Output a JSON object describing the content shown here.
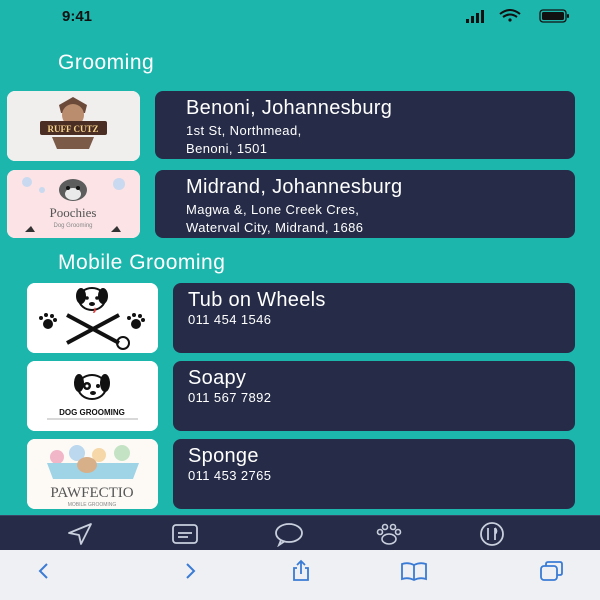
{
  "status": {
    "time": "9:41"
  },
  "sections": {
    "grooming_title": "Grooming",
    "mobile_title": "Mobile Grooming"
  },
  "grooming": [
    {
      "name": "Benoni, Johannesburg",
      "line1": "1st St, Northmead,",
      "line2": "Benoni, 1501",
      "logo_text": "RUFF CUTZ"
    },
    {
      "name": "Midrand, Johannesburg",
      "line1": "Magwa &, Lone Creek Cres,",
      "line2": "Waterval City, Midrand, 1686",
      "logo_text": "Poochies",
      "logo_sub": "Dog Grooming"
    }
  ],
  "mobile": [
    {
      "name": "Tub on Wheels",
      "phone": "011 454 1546"
    },
    {
      "name": "Soapy",
      "phone": "011 567 7892",
      "logo_text": "DOG GROOMING"
    },
    {
      "name": "Sponge",
      "phone": "011 453 2765",
      "logo_text": "PAWFECTIO",
      "logo_sub": "MOBILE GROOMING"
    }
  ],
  "tabs": [
    "navigate-icon",
    "card-icon",
    "chat-icon",
    "paw-icon",
    "dining-icon"
  ],
  "browser": [
    "back-icon",
    "forward-icon",
    "share-icon",
    "bookmarks-icon",
    "tabs-icon"
  ],
  "colors": {
    "background": "#1db6ad",
    "card": "#262c48",
    "accent": "#3a7bd5"
  }
}
